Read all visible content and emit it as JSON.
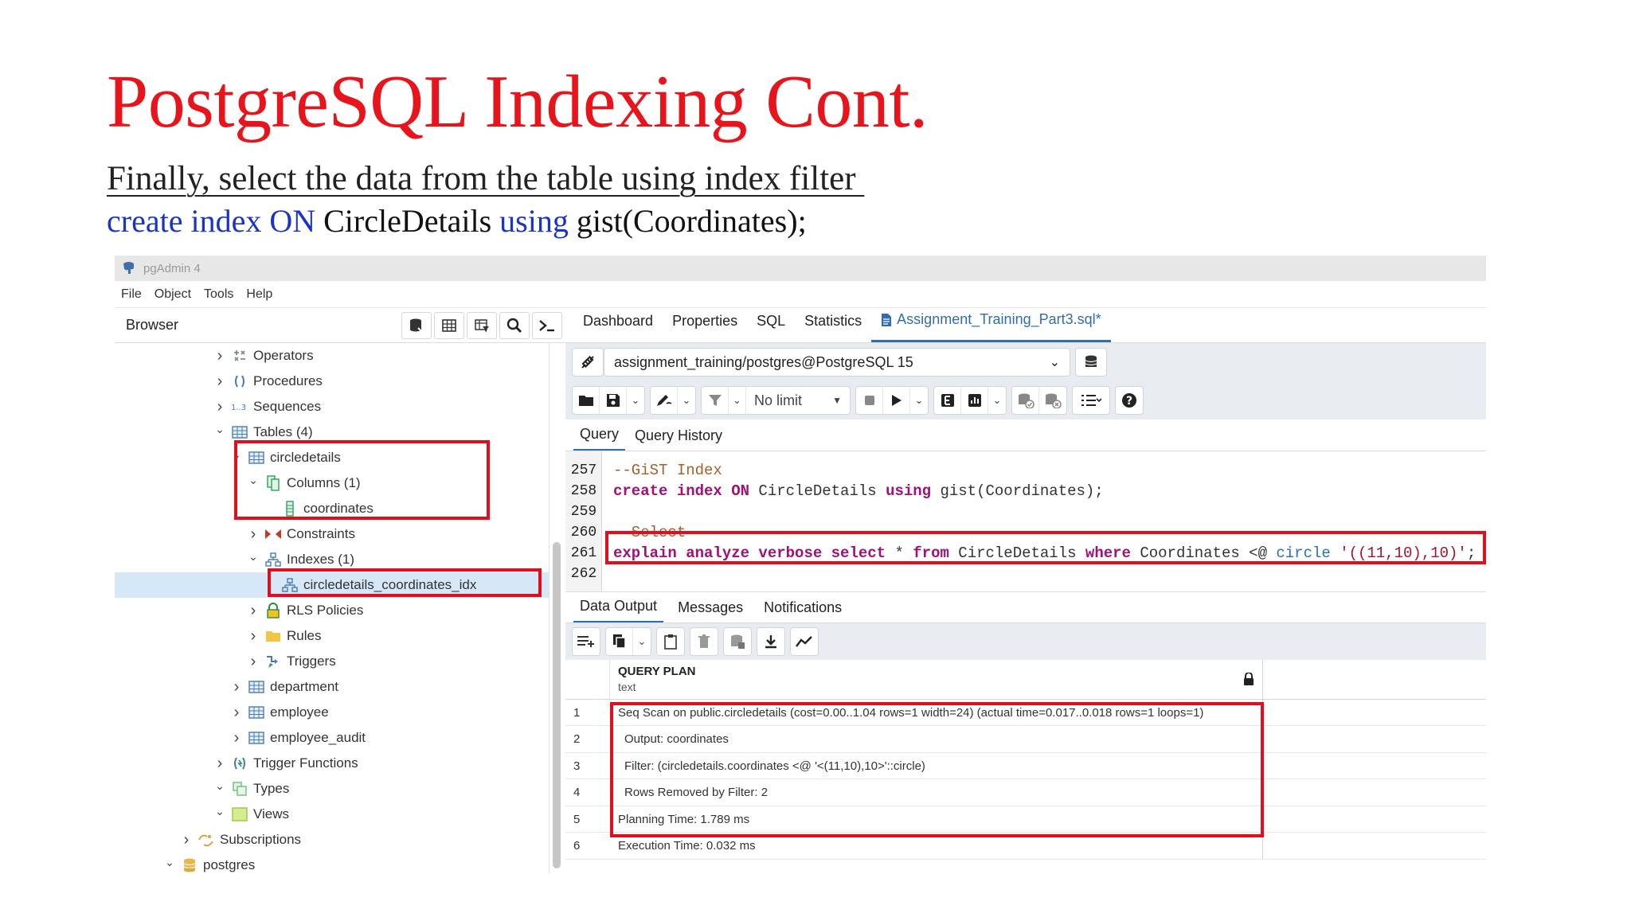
{
  "slide": {
    "title": "PostgreSQL Indexing Cont.",
    "subtitle": "Finally, select the data from the table using index filter ",
    "code_parts": [
      "create index ON",
      " CircleDetails ",
      "using",
      " gist(Coordinates);"
    ]
  },
  "app": {
    "window_title": "pgAdmin 4",
    "menu": [
      "File",
      "Object",
      "Tools",
      "Help"
    ],
    "browser_label": "Browser"
  },
  "tree": [
    {
      "label": "Operators",
      "icon": "operators-icon",
      "chevron": "›"
    },
    {
      "label": "Procedures",
      "icon": "procedures-icon",
      "chevron": "›"
    },
    {
      "label": "Sequences",
      "icon": "sequences-icon",
      "chevron": "›"
    },
    {
      "label": "Tables (4)",
      "icon": "table-icon",
      "chevron": "⌄"
    },
    {
      "label": "circledetails",
      "icon": "table-icon",
      "chevron": "⌄"
    },
    {
      "label": "Columns (1)",
      "icon": "columns-icon",
      "chevron": "⌄"
    },
    {
      "label": "coordinates",
      "icon": "column-icon",
      "chevron": ""
    },
    {
      "label": "Constraints",
      "icon": "constraints-icon",
      "chevron": "›"
    },
    {
      "label": "Indexes (1)",
      "icon": "index-icon",
      "chevron": "⌄"
    },
    {
      "label": "circledetails_coordinates_idx",
      "icon": "index-icon",
      "chevron": ""
    },
    {
      "label": "RLS Policies",
      "icon": "rls-icon",
      "chevron": "›"
    },
    {
      "label": "Rules",
      "icon": "rules-icon",
      "chevron": "›"
    },
    {
      "label": "Triggers",
      "icon": "triggers-icon",
      "chevron": "›"
    },
    {
      "label": "department",
      "icon": "table-icon",
      "chevron": "›"
    },
    {
      "label": "employee",
      "icon": "table-icon",
      "chevron": "›"
    },
    {
      "label": "employee_audit",
      "icon": "table-icon",
      "chevron": "›"
    },
    {
      "label": "Trigger Functions",
      "icon": "trigger-functions-icon",
      "chevron": "›"
    },
    {
      "label": "Types",
      "icon": "types-icon",
      "chevron": "⌄"
    },
    {
      "label": "Views",
      "icon": "views-icon",
      "chevron": "⌄"
    },
    {
      "label": "Subscriptions",
      "icon": "subscriptions-icon",
      "chevron": "›"
    },
    {
      "label": "postgres",
      "icon": "database-icon",
      "chevron": "⌄"
    }
  ],
  "tabs": [
    "Dashboard",
    "Properties",
    "SQL",
    "Statistics",
    "Assignment_Training_Part3.sql*"
  ],
  "connection": "assignment_training/postgres@PostgreSQL 15",
  "toolbar": {
    "no_limit": "No limit"
  },
  "query_tabs": [
    "Query",
    "Query History"
  ],
  "editor": {
    "lines": [
      {
        "n": "257",
        "parts": [
          [
            "c-comment",
            "--GiST Index"
          ]
        ]
      },
      {
        "n": "258",
        "parts": [
          [
            "c-kw",
            "create index ON"
          ],
          [
            "",
            " CircleDetails "
          ],
          [
            "c-kw",
            "using"
          ],
          [
            "",
            " gist(Coordinates);"
          ]
        ]
      },
      {
        "n": "259",
        "parts": []
      },
      {
        "n": "260",
        "parts": [
          [
            "c-comment",
            "--Select"
          ]
        ]
      },
      {
        "n": "261",
        "parts": [
          [
            "c-kw",
            "explain analyze verbose select"
          ],
          [
            "",
            " * "
          ],
          [
            "c-kw",
            "from"
          ],
          [
            "",
            " CircleDetails "
          ],
          [
            "c-kw",
            "where"
          ],
          [
            "",
            " Coordinates <@ "
          ],
          [
            "c-type",
            "circle"
          ],
          [
            "",
            " "
          ],
          [
            "c-str",
            "'((11,10),10)'"
          ],
          [
            "",
            ";"
          ]
        ]
      },
      {
        "n": "262",
        "parts": []
      }
    ]
  },
  "result_tabs": [
    "Data Output",
    "Messages",
    "Notifications"
  ],
  "grid": {
    "column_name": "QUERY PLAN",
    "column_type": "text",
    "rows": [
      {
        "n": "1",
        "text": "Seq Scan on public.circledetails  (cost=0.00..1.04 rows=1 width=24) (actual time=0.017..0.018 rows=1 loops=1)",
        "indent": false
      },
      {
        "n": "2",
        "text": "Output: coordinates",
        "indent": true
      },
      {
        "n": "3",
        "text": "Filter: (circledetails.coordinates <@ '<(11,10),10>'::circle)",
        "indent": true
      },
      {
        "n": "4",
        "text": "Rows Removed by Filter: 2",
        "indent": true
      },
      {
        "n": "5",
        "text": "Planning Time: 1.789 ms",
        "indent": false
      },
      {
        "n": "6",
        "text": "Execution Time: 0.032 ms",
        "indent": false
      }
    ]
  },
  "colors": {
    "title_red": "#e8141b",
    "keyword_blue": "#1a34c8",
    "highlight_red": "#e00f1e",
    "accent_blue": "#326bb0"
  }
}
